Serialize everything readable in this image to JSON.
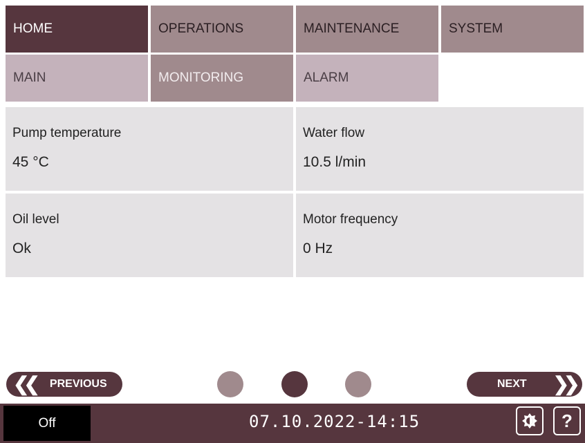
{
  "nav": {
    "main_tabs": [
      "HOME",
      "OPERATIONS",
      "MAINTENANCE",
      "SYSTEM"
    ],
    "sub_tabs": [
      "MAIN",
      "MONITORING",
      "ALARM"
    ],
    "active_main": "HOME",
    "active_sub": "MONITORING"
  },
  "monitoring": [
    {
      "label": "Pump temperature",
      "value": "45 °C"
    },
    {
      "label": "Water flow",
      "value": "10.5 l/min"
    },
    {
      "label": "Oil level",
      "value": "Ok"
    },
    {
      "label": "Motor frequency",
      "value": "0 Hz"
    }
  ],
  "pager": {
    "previous_label": "PREVIOUS",
    "next_label": "NEXT",
    "page_count": 3,
    "current_page": 2
  },
  "footer": {
    "status": "Off",
    "datetime": "07.10.2022-14:15",
    "help_label": "?"
  },
  "icons": {
    "prev": "double-chevron-left-icon",
    "next": "double-chevron-right-icon",
    "display": "brightness-icon"
  },
  "colors": {
    "primary": "#56363e",
    "secondary": "#a08a8d",
    "tertiary": "#c4b2bb",
    "panel": "#e4e2e4"
  }
}
